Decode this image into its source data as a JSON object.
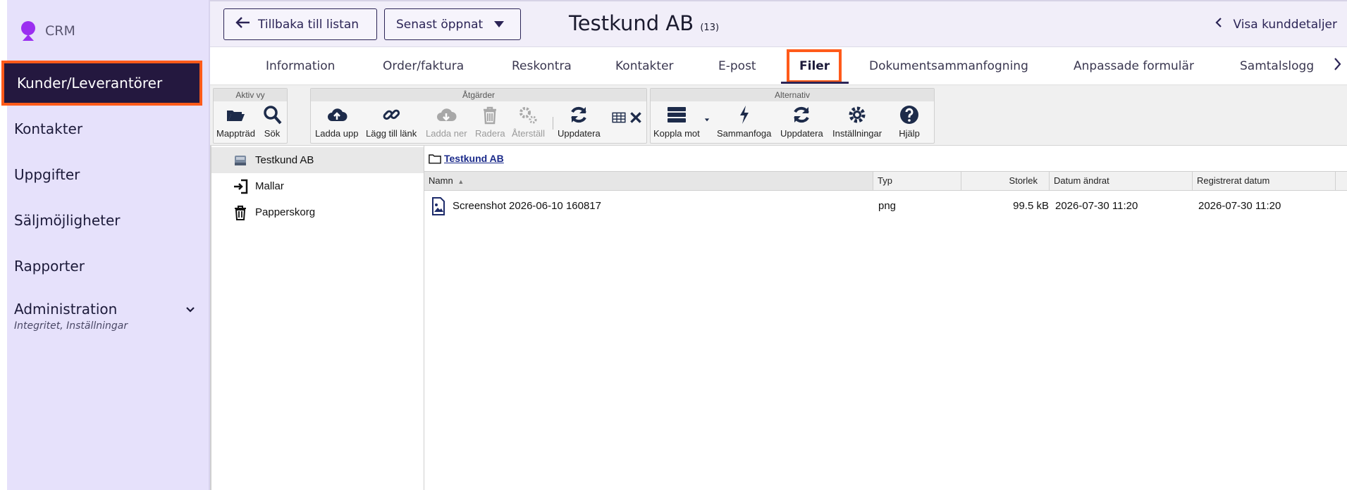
{
  "sidebar": {
    "brand": "CRM",
    "items": [
      {
        "label": "Kunder/Leverantörer"
      },
      {
        "label": "Kontakter"
      },
      {
        "label": "Uppgifter"
      },
      {
        "label": "Säljmöjligheter"
      },
      {
        "label": "Rapporter"
      },
      {
        "label": "Administration",
        "sub": "Integritet, Inställningar"
      }
    ]
  },
  "header": {
    "back_label": "Tillbaka till listan",
    "recent_label": "Senast öppnat",
    "title": "Testkund AB",
    "count": "(13)",
    "details_label": "Visa kunddetaljer"
  },
  "tabs": [
    "Information",
    "Order/faktura",
    "Reskontra",
    "Kontakter",
    "E-post",
    "Filer",
    "Dokumentsammanfogning",
    "Anpassade formulär",
    "Samtalslogg"
  ],
  "toolbar": {
    "groups": {
      "active_view": "Aktiv vy",
      "actions": "Åtgärder",
      "options": "Alternativ"
    },
    "buttons": {
      "folder_tree": "Mappträd",
      "search": "Sök",
      "upload": "Ladda upp",
      "add_link": "Lägg till länk",
      "download": "Ladda ner",
      "delete": "Radera",
      "restore": "Återställ",
      "refresh": "Uppdatera",
      "connect": "Koppla mot",
      "merge": "Sammanfoga",
      "refresh2": "Uppdatera",
      "settings": "Inställningar",
      "help": "Hjälp"
    }
  },
  "tree": [
    "Testkund AB",
    "Mallar",
    "Papperskorg"
  ],
  "breadcrumb": "Testkund AB",
  "table": {
    "columns": [
      "Namn",
      "Typ",
      "Storlek",
      "Datum ändrat",
      "Registrerat datum"
    ],
    "rows": [
      {
        "name": "Screenshot 2026-06-10 160817",
        "type": "png",
        "size": "99.5 kB",
        "modified": "2026-07-30 11:20",
        "registered": "2026-07-30 11:20"
      }
    ]
  },
  "colors": {
    "accent": "#ff5a1a",
    "nav_active": "#24183f",
    "sidebar_bg": "#e6e1fb",
    "brand": "#9b2ff0"
  }
}
